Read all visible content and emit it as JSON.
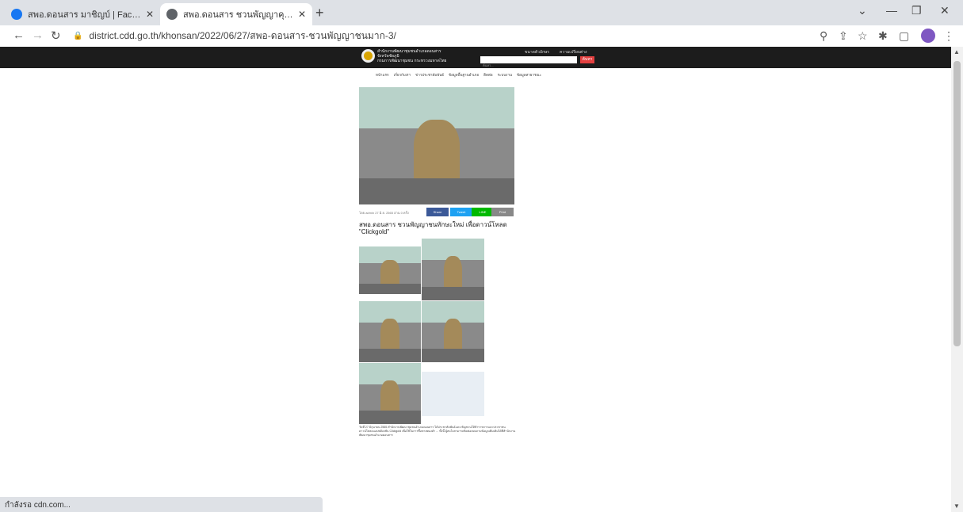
{
  "tabs": [
    {
      "title": "สพอ.ดอนสาร มาชิญบ์ | Facebook",
      "favicon_color": "#1877f2"
    },
    {
      "title": "สพอ.ดอนสาร ชวนพัญญาคุณทะเบียนใช้...",
      "favicon_color": "#5f6368"
    }
  ],
  "toolbar": {
    "url": "district.cdd.go.th/khonsan/2022/06/27/สพอ-ดอนสาร-ชวนพัญญาชนมาก-3/"
  },
  "site": {
    "org_name_line1": "สำนักงานพัฒนาชุมชนอำเภอดอนสาร",
    "org_name_line2": "จังหวัดชัยภูมิ",
    "org_name_line3": "กรมการพัฒนาชุมชน กระทรวงมหาดไทย",
    "font_label": "ขนาดตัวอักษร",
    "contrast_label": "ความเปรียบต่าง",
    "search_placeholder": "ค้นหา...",
    "search_button": "ค้นหา",
    "menu": [
      "หน้าแรก",
      "เกี่ยวกับเรา",
      "ข่าวประชาสัมพันธ์",
      "ข้อมูลพื้นฐานอำเภอ",
      "ติดต่อ",
      "ระบบงาน",
      "ข้อมูลสาธารณะ"
    ]
  },
  "article": {
    "meta": "โดย admin  27 มิ.ย. 2565  อ่าน 0 ครั้ง",
    "share": [
      {
        "label": "Share",
        "color": "#3b5998"
      },
      {
        "label": "Tweet",
        "color": "#1da1f2"
      },
      {
        "label": "LINE",
        "color": "#00b900"
      },
      {
        "label": "Print",
        "color": "#888888"
      }
    ],
    "title": "สพอ.ดอนสาร ชวนพัญญาชนทักษะใหม่ เพื่อดาวน์โหลด \"Clickgold\"",
    "body": "วันที่ 27 มิถุนายน 2565 สำนักงานพัฒนาชุมชนอำเภอดอนสาร ได้ประชาสัมพันธ์และเชิญชวนให้ข้าราชการและประชาชนดาวน์โหลดแอปพลิเคชัน Clickgold เพื่อใช้ในการซื้อขายทองคำ ... ทั้งนี้ ผู้สนใจสามารถติดต่อสอบถามข้อมูลเพิ่มเติมได้ที่สำนักงานพัฒนาชุมชนอำเภอดอนสาร"
  },
  "status_bar": "กำลังรอ cdn.com..."
}
